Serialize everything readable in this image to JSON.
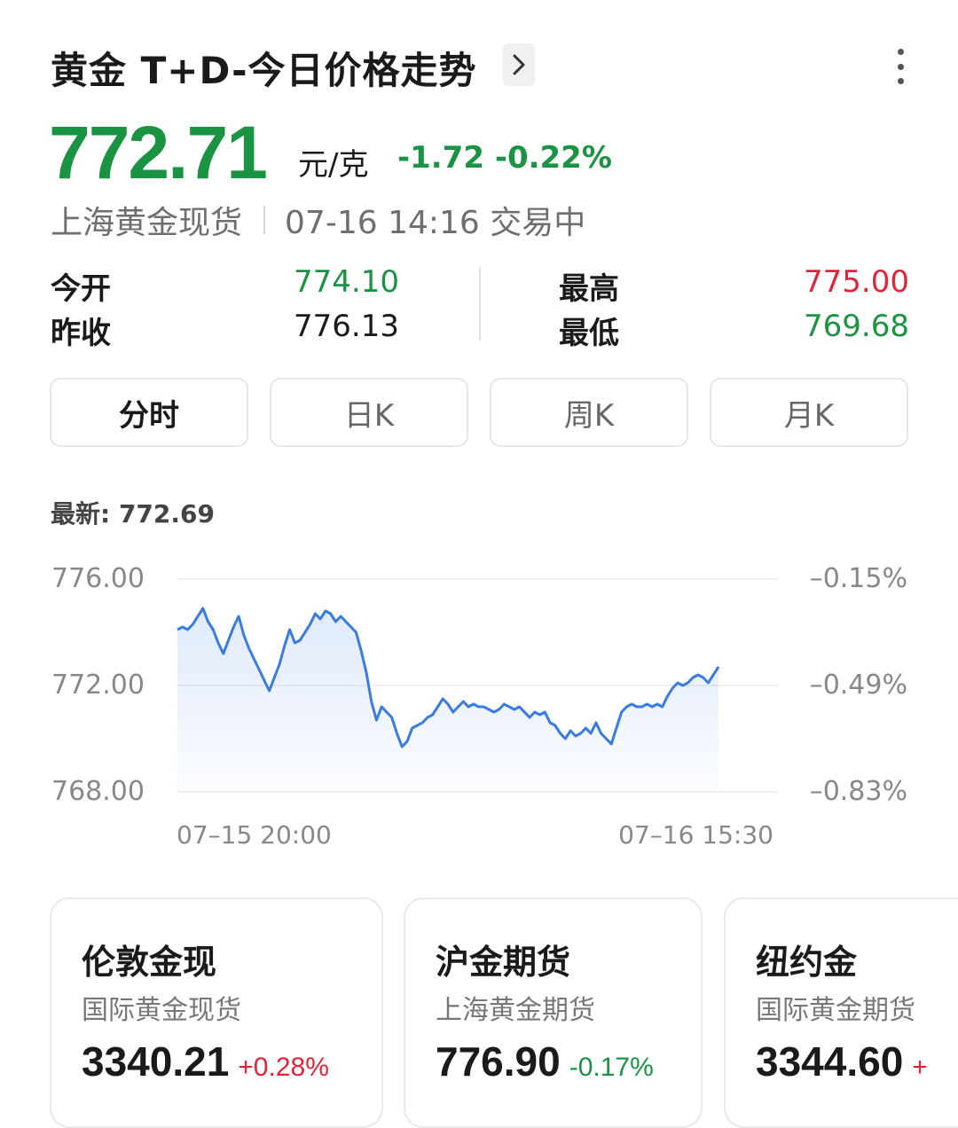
{
  "header": {
    "title": "黄金 T+D-今日价格走势",
    "arrow_icon": "chevron-right-icon",
    "menu_icon": "more-vertical-icon"
  },
  "quote": {
    "price": "772.71",
    "unit": "元/克",
    "change": "-1.72 -0.22%",
    "market": "上海黄金现货",
    "datetime_status": "07-16 14:16 交易中"
  },
  "stats": {
    "open_label": "今开",
    "open_value": "774.10",
    "prev_close_label": "昨收",
    "prev_close_value": "776.13",
    "high_label": "最高",
    "high_value": "775.00",
    "low_label": "最低",
    "low_value": "769.68"
  },
  "tabs": [
    {
      "label": "分时",
      "active": true
    },
    {
      "label": "日K",
      "active": false
    },
    {
      "label": "周K",
      "active": false
    },
    {
      "label": "月K",
      "active": false
    }
  ],
  "latest_label": "最新: 772.69",
  "chart_data": {
    "type": "area",
    "ylim": [
      768,
      776
    ],
    "y_ticks": [
      "776.00",
      "772.00",
      "768.00"
    ],
    "y2_ticks": [
      "–0.15%",
      "–0.49%",
      "–0.83%"
    ],
    "x_labels": [
      "07–15 20:00",
      "07–16 15:30"
    ],
    "values": [
      774.1,
      774.2,
      774.1,
      774.3,
      774.6,
      774.9,
      774.4,
      774.1,
      773.6,
      773.2,
      773.7,
      774.2,
      774.6,
      773.9,
      773.4,
      773.0,
      772.6,
      772.2,
      771.8,
      772.3,
      772.8,
      773.5,
      774.1,
      773.6,
      773.7,
      774.0,
      774.3,
      774.7,
      774.5,
      774.8,
      774.7,
      774.4,
      774.6,
      774.4,
      774.2,
      774.0,
      773.3,
      772.5,
      771.4,
      770.7,
      771.2,
      771.0,
      770.8,
      770.2,
      769.7,
      769.9,
      770.4,
      770.5,
      770.6,
      770.8,
      770.9,
      771.2,
      771.5,
      771.3,
      771.0,
      771.2,
      771.4,
      771.2,
      771.3,
      771.2,
      771.2,
      771.1,
      771.0,
      771.1,
      771.3,
      771.2,
      771.1,
      771.2,
      771.0,
      770.8,
      771.0,
      770.9,
      771.0,
      770.6,
      770.5,
      770.2,
      770.0,
      770.3,
      770.1,
      770.2,
      770.4,
      770.2,
      770.6,
      770.2,
      770.0,
      769.8,
      770.4,
      771.0,
      771.2,
      771.3,
      771.2,
      771.2,
      771.3,
      771.2,
      771.3,
      771.2,
      771.6,
      771.9,
      772.1,
      772.0,
      772.1,
      772.3,
      772.4,
      772.3,
      772.1,
      772.4,
      772.7
    ]
  },
  "cards": [
    {
      "title": "伦敦金现",
      "subtitle": "国际黄金现货",
      "price": "3340.21",
      "change": "+0.28%",
      "color": "#e0243a"
    },
    {
      "title": "沪金期货",
      "subtitle": "上海黄金期货",
      "price": "776.90",
      "change": "-0.17%",
      "color": "#1a9443"
    },
    {
      "title": "纽约金",
      "subtitle": "国际黄金期货",
      "price": "3344.60",
      "change": "+",
      "color": "#e0243a"
    }
  ],
  "colors": {
    "up": "#e0243a",
    "down": "#1a9443",
    "line": "#3a7be0"
  }
}
